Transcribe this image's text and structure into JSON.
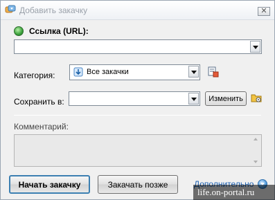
{
  "window": {
    "title": "Добавить закачку",
    "close_glyph": "✕"
  },
  "url": {
    "label": "Ссылка (URL):",
    "value": "",
    "icon": "globe-icon"
  },
  "category": {
    "label": "Категория:",
    "selected": "Все закачки",
    "icon": "download-category-icon",
    "manage_icon": "category-manage-icon"
  },
  "save": {
    "label": "Сохранить в:",
    "value": "",
    "change_label": "Изменить",
    "folder_icon": "folder-icon"
  },
  "comment": {
    "label": "Комментарий:",
    "value": ""
  },
  "buttons": {
    "start": "Начать закачку",
    "later": "Закачать позже",
    "more": "Дополнительно"
  },
  "watermark": "life.on-portal.ru",
  "colors": {
    "link": "#1c5fb0",
    "default_button_border": "#3c7fb1",
    "window_bg": "#f0f0f0"
  }
}
